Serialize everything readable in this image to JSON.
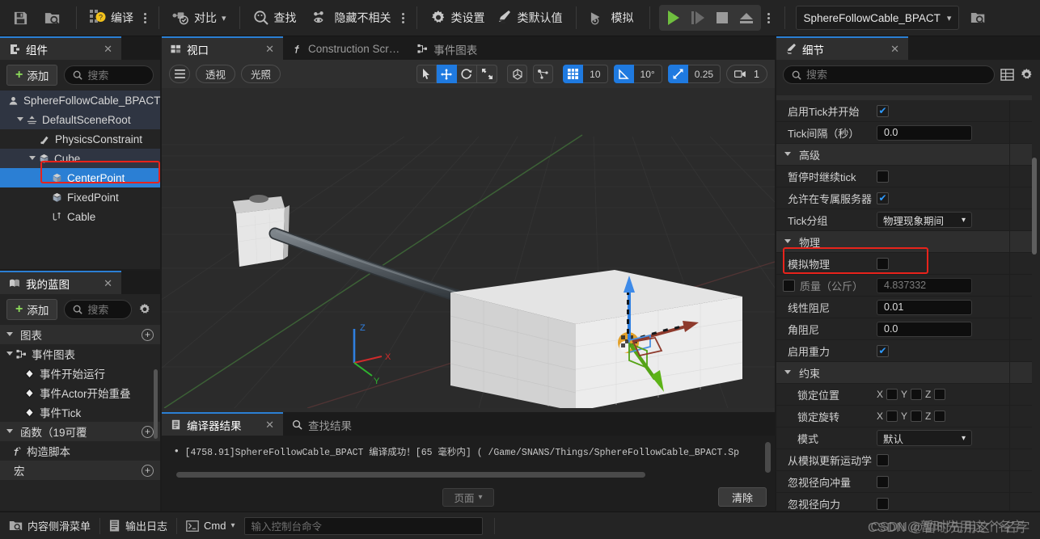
{
  "toolbar": {
    "save_label": "",
    "browse_label": "",
    "compile_label": "编译",
    "diff_label": "对比",
    "find_label": "查找",
    "hide_unrelated_label": "隐藏不相关",
    "class_settings_label": "类设置",
    "class_defaults_label": "类默认值",
    "simulate_label": "模拟",
    "blueprint_name": "SphereFollowCable_BPACT"
  },
  "components_panel": {
    "tab_label": "组件",
    "add_label": "添加",
    "search_placeholder": "搜索",
    "items": [
      {
        "label": "SphereFollowCable_BPACT",
        "depth": 0,
        "icon": "actor-icon",
        "state": "highlight",
        "arrow": "none"
      },
      {
        "label": "DefaultSceneRoot",
        "depth": 1,
        "icon": "scene-root-icon",
        "state": "highlight",
        "arrow": "open"
      },
      {
        "label": "PhysicsConstraint",
        "depth": 2,
        "icon": "physics-constraint-icon",
        "state": "normal",
        "arrow": "none"
      },
      {
        "label": "Cube",
        "depth": 2,
        "icon": "cube-icon",
        "state": "highlight",
        "arrow": "open"
      },
      {
        "label": "CenterPoint",
        "depth": 3,
        "icon": "cube-icon",
        "state": "selected",
        "arrow": "none"
      },
      {
        "label": "FixedPoint",
        "depth": 3,
        "icon": "cube-icon",
        "state": "normal",
        "arrow": "none"
      },
      {
        "label": "Cable",
        "depth": 3,
        "icon": "cable-icon",
        "state": "normal",
        "arrow": "none"
      }
    ]
  },
  "myblueprint_panel": {
    "tab_label": "我的蓝图",
    "add_label": "添加",
    "search_placeholder": "搜索",
    "sections": [
      {
        "label": "图表",
        "has_plus": true
      },
      {
        "label": "函数（19可覆",
        "has_plus": true
      },
      {
        "label": "宏",
        "has_plus": true
      }
    ],
    "graph_root": "事件图表",
    "graph_events": [
      "事件开始运行",
      "事件Actor开始重叠",
      "事件Tick"
    ],
    "function_items": [
      "构造脚本"
    ]
  },
  "viewport": {
    "tabs": [
      {
        "label": "视口",
        "icon": "viewport-icon",
        "active": true,
        "closable": true
      },
      {
        "label": "Construction Scr…",
        "icon": "function-icon",
        "active": false,
        "closable": false
      },
      {
        "label": "事件图表",
        "icon": "graph-icon",
        "active": false,
        "closable": false
      }
    ],
    "menu_icon": "hamburger-icon",
    "perspective_label": "透视",
    "lighting_label": "光照",
    "grid_snap_value": "10",
    "angle_snap_value": "10°",
    "scale_snap_value": "0.25",
    "camera_speed_value": "1",
    "axis_x": "X",
    "axis_y": "Y",
    "axis_z": "Z"
  },
  "compiler_panel": {
    "tabs": [
      {
        "label": "编译器结果",
        "icon": "compiler-icon",
        "active": true,
        "closable": true
      },
      {
        "label": "查找结果",
        "icon": "search-icon",
        "active": false,
        "closable": false
      }
    ],
    "message": "[4758.91]SphereFollowCable_BPACT 编译成功！[65 毫秒内] ( /Game/SNANS/Things/SphereFollowCable_BPACT.Sp",
    "page_label": "页面",
    "clear_label": "清除"
  },
  "details_panel": {
    "tab_label": "细节",
    "search_placeholder": "搜索",
    "rows": [
      {
        "label": "启用Tick并开始",
        "type": "checkbox",
        "checked": true,
        "indent": 0
      },
      {
        "label": "Tick间隔（秒）",
        "type": "number",
        "value": "0.0",
        "indent": 0
      },
      {
        "label": "高级",
        "type": "category",
        "indent": 0
      },
      {
        "label": "暂停时继续tick",
        "type": "checkbox",
        "checked": false,
        "indent": 0
      },
      {
        "label": "允许在专属服务器…",
        "type": "checkbox",
        "checked": true,
        "indent": 0
      },
      {
        "label": "Tick分组",
        "type": "dropdown",
        "value": "物理现象期间",
        "indent": 0
      },
      {
        "label": "物理",
        "type": "category",
        "indent": 0
      },
      {
        "label": "模拟物理",
        "type": "checkbox",
        "checked": false,
        "indent": 0,
        "highlighted": true
      },
      {
        "label": "质量（公斤）",
        "type": "number-disabled",
        "value": "4.837332",
        "indent": 0,
        "prefix_checkbox": true
      },
      {
        "label": "线性阻尼",
        "type": "number",
        "value": "0.01",
        "indent": 0
      },
      {
        "label": "角阻尼",
        "type": "number",
        "value": "0.0",
        "indent": 0
      },
      {
        "label": "启用重力",
        "type": "checkbox",
        "checked": true,
        "indent": 0
      },
      {
        "label": "约束",
        "type": "category",
        "indent": 0
      },
      {
        "label": "锁定位置",
        "type": "xyz",
        "axes": [
          "X",
          "Y",
          "Z"
        ],
        "indent": 1
      },
      {
        "label": "锁定旋转",
        "type": "xyz",
        "axes": [
          "X",
          "Y",
          "Z"
        ],
        "indent": 1
      },
      {
        "label": "模式",
        "type": "dropdown",
        "value": "默认",
        "indent": 1
      },
      {
        "label": "从模拟更新运动学",
        "type": "checkbox",
        "checked": false,
        "indent": 0
      },
      {
        "label": "忽视径向冲量",
        "type": "checkbox",
        "checked": false,
        "indent": 0
      },
      {
        "label": "忽视径向力",
        "type": "checkbox",
        "checked": false,
        "indent": 0
      }
    ]
  },
  "statusbar": {
    "content_drawer_label": "内容侧滑菜单",
    "output_log_label": "输出日志",
    "cmd_label": "Cmd",
    "cmd_placeholder": "输入控制台命令"
  },
  "watermark": {
    "text1": "CSDN @暂时先用这个名字",
    "text2": "CSDN@暂时先用这个名字"
  },
  "colors": {
    "accent_blue": "#1f7ae0",
    "selection_blue": "#2b7fd4",
    "green": "#6fbf3f",
    "highlight_red": "#e8231b"
  }
}
